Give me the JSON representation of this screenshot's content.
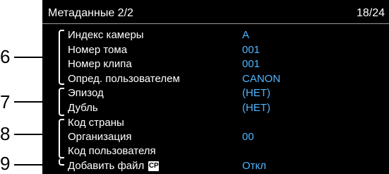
{
  "header": {
    "title": "Метаданные 2/2",
    "page": "18/24"
  },
  "callouts": [
    "6",
    "7",
    "8",
    "9"
  ],
  "rows": [
    {
      "label": "Индекс камеры",
      "value": "A"
    },
    {
      "label": "Номер тома",
      "value": "001"
    },
    {
      "label": "Номер клипа",
      "value": "001"
    },
    {
      "label": "Опред. пользователем",
      "value": "CANON"
    },
    {
      "label": "Эпизод",
      "value": "(НЕТ)"
    },
    {
      "label": "Дубль",
      "value": "(НЕТ)"
    },
    {
      "label": "Код страны",
      "value": ""
    },
    {
      "label": "Организация",
      "value": "00"
    },
    {
      "label": "Код пользователя",
      "value": ""
    },
    {
      "label": "Добавить файл",
      "value": "Откл",
      "icon": "cp-icon",
      "icon_text": "CP"
    }
  ],
  "colors": {
    "screen_bg": "#000000",
    "value_text": "#4fb4ff",
    "label_text": "#ffffff"
  }
}
